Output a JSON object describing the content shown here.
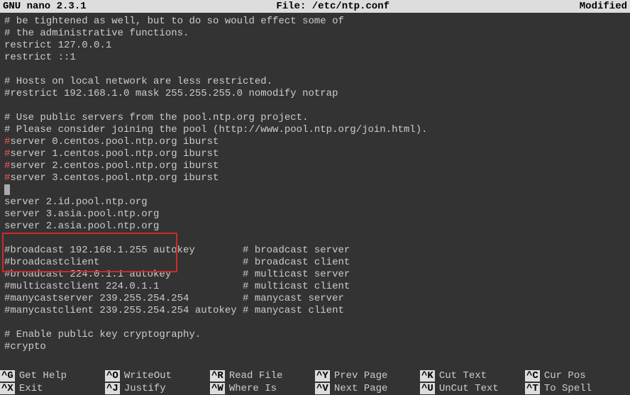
{
  "titlebar": {
    "app": "  GNU nano 2.3.1",
    "file": "File: /etc/ntp.conf",
    "status": "Modified"
  },
  "lines": [
    {
      "text": "# be tightened as well, but to do so would effect some of"
    },
    {
      "text": "# the administrative functions."
    },
    {
      "text": "restrict 127.0.0.1"
    },
    {
      "text": "restrict ::1"
    },
    {
      "text": ""
    },
    {
      "text": "# Hosts on local network are less restricted."
    },
    {
      "text": "#restrict 192.168.1.0 mask 255.255.255.0 nomodify notrap"
    },
    {
      "text": ""
    },
    {
      "text": "# Use public servers from the pool.ntp.org project."
    },
    {
      "text": "# Please consider joining the pool (http://www.pool.ntp.org/join.html)."
    },
    {
      "hash": true,
      "text": "server 0.centos.pool.ntp.org iburst"
    },
    {
      "hash": true,
      "text": "server 1.centos.pool.ntp.org iburst"
    },
    {
      "hash": true,
      "text": "server 2.centos.pool.ntp.org iburst"
    },
    {
      "hash": true,
      "text": "server 3.centos.pool.ntp.org iburst"
    },
    {
      "cursor": true,
      "text": ""
    },
    {
      "text": "server 2.id.pool.ntp.org"
    },
    {
      "text": "server 3.asia.pool.ntp.org"
    },
    {
      "text": "server 2.asia.pool.ntp.org"
    },
    {
      "text": ""
    },
    {
      "text": "#broadcast 192.168.1.255 autokey        # broadcast server"
    },
    {
      "text": "#broadcastclient                        # broadcast client"
    },
    {
      "text": "#broadcast 224.0.1.1 autokey            # multicast server"
    },
    {
      "text": "#multicastclient 224.0.1.1              # multicast client"
    },
    {
      "text": "#manycastserver 239.255.254.254         # manycast server"
    },
    {
      "text": "#manycastclient 239.255.254.254 autokey # manycast client"
    },
    {
      "text": ""
    },
    {
      "text": "# Enable public key cryptography."
    },
    {
      "text": "#crypto"
    }
  ],
  "shortcuts": {
    "row1": [
      {
        "key": "^G",
        "label": "Get Help"
      },
      {
        "key": "^O",
        "label": "WriteOut"
      },
      {
        "key": "^R",
        "label": "Read File"
      },
      {
        "key": "^Y",
        "label": "Prev Page"
      },
      {
        "key": "^K",
        "label": "Cut Text"
      },
      {
        "key": "^C",
        "label": "Cur Pos"
      }
    ],
    "row2": [
      {
        "key": "^X",
        "label": "Exit"
      },
      {
        "key": "^J",
        "label": "Justify"
      },
      {
        "key": "^W",
        "label": "Where Is"
      },
      {
        "key": "^V",
        "label": "Next Page"
      },
      {
        "key": "^U",
        "label": "UnCut Text"
      },
      {
        "key": "^T",
        "label": "To Spell"
      }
    ]
  }
}
